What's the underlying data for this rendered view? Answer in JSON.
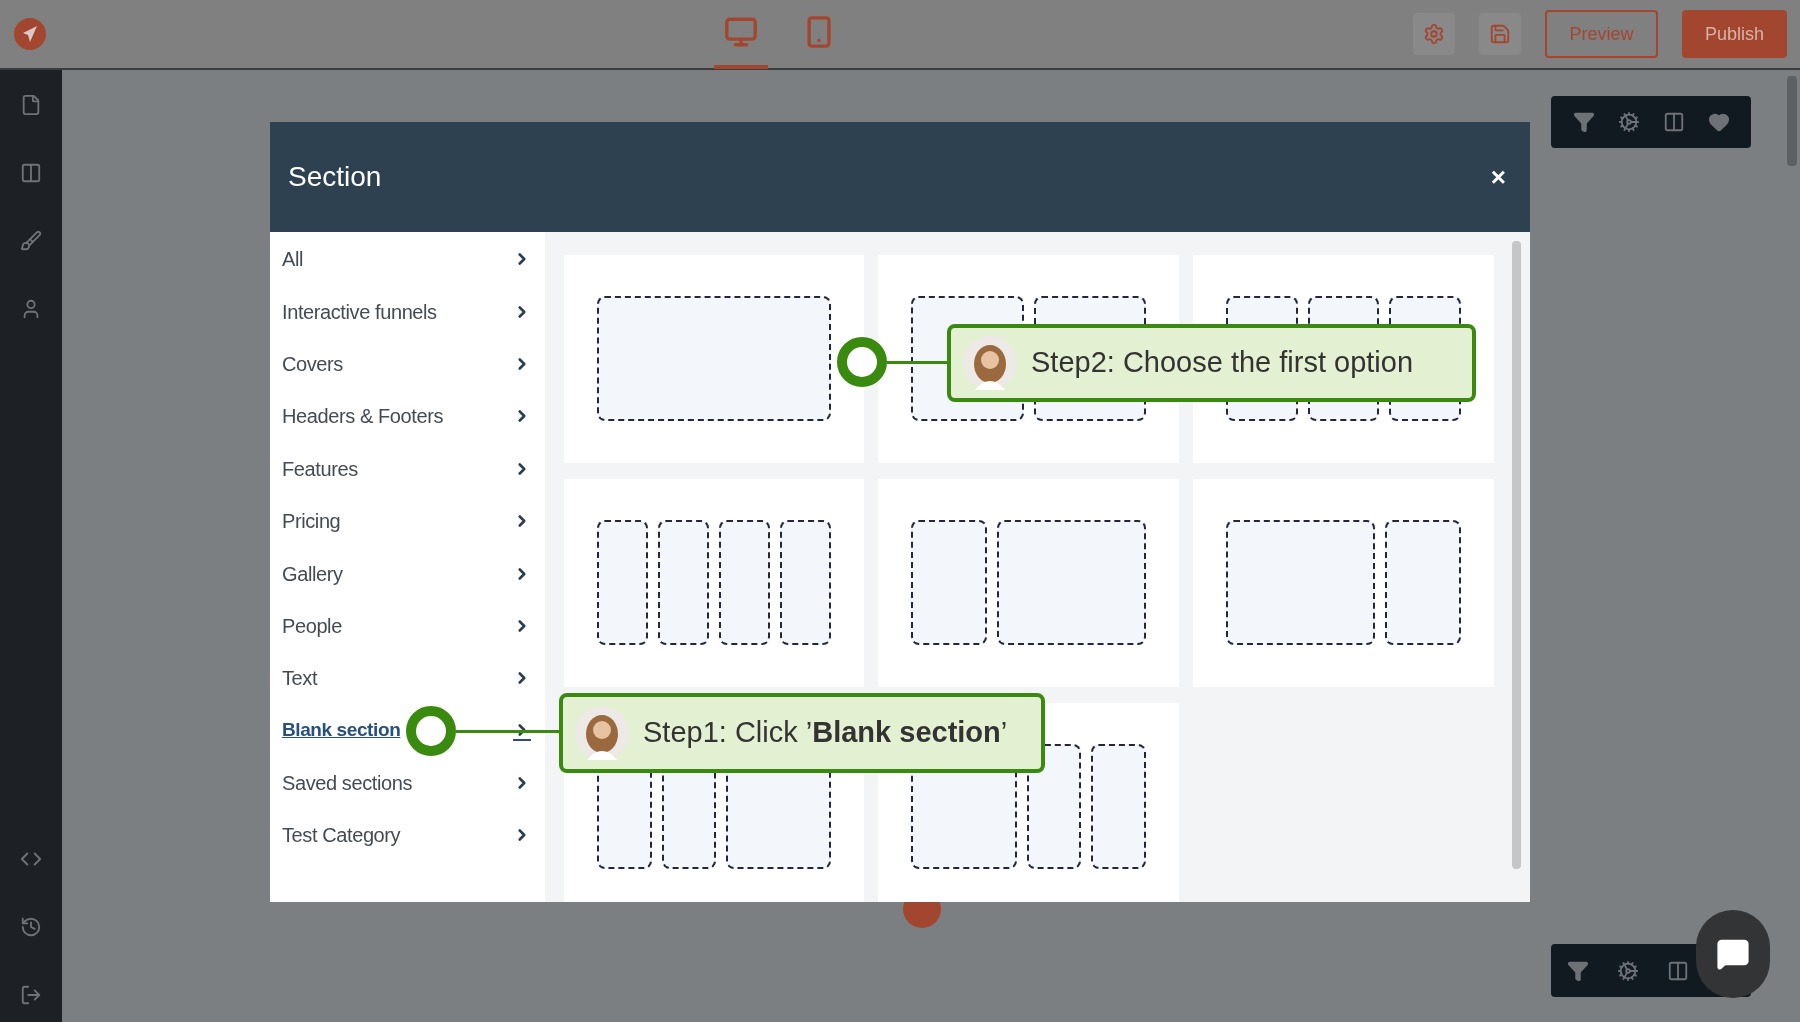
{
  "top_bar": {
    "device_tabs": [
      {
        "kind": "desktop",
        "selected": true
      },
      {
        "kind": "mobile",
        "selected": false
      }
    ],
    "buttons": [
      {
        "label": "Preview",
        "kind": "outline"
      },
      {
        "label": "Publish",
        "kind": "filled"
      }
    ]
  },
  "modal": {
    "title": "Section",
    "close": "×",
    "categories": [
      {
        "label": "All",
        "selected": false
      },
      {
        "label": "Interactive funnels",
        "selected": false
      },
      {
        "label": "Covers",
        "selected": false
      },
      {
        "label": "Headers & Footers",
        "selected": false
      },
      {
        "label": "Features",
        "selected": false
      },
      {
        "label": "Pricing",
        "selected": false
      },
      {
        "label": "Gallery",
        "selected": false
      },
      {
        "label": "People",
        "selected": false
      },
      {
        "label": "Text",
        "selected": false
      },
      {
        "label": "Blank section",
        "selected": true
      },
      {
        "label": "Saved sections",
        "selected": false
      },
      {
        "label": "Test Category",
        "selected": false
      }
    ]
  },
  "annotations": [
    {
      "text": "Step2: Choose the first option"
    },
    {
      "text": "Step1: Click ’**Blank section**’"
    }
  ]
}
